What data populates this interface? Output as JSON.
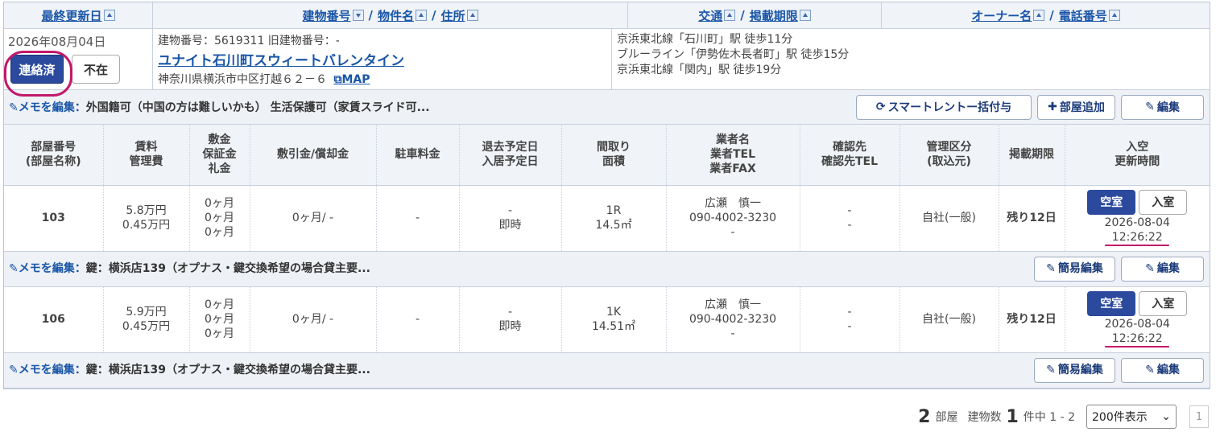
{
  "header": {
    "col1": "最終更新日",
    "col2a": "建物番号",
    "col2b": "物件名",
    "col2c": "住所",
    "col3a": "交通",
    "col3b": "掲載期限",
    "col4a": "オーナー名",
    "col4b": "電話番号",
    "sep": "/"
  },
  "building": {
    "date": "2026年08月04日",
    "contacted_label": "連絡済",
    "absent_label": "不在",
    "number_line": "建物番号：5619311 旧建物番号：-",
    "name": "ユナイト石川町スウィートバレンタイン",
    "address": "神奈川県横浜市中区打越６２－６",
    "map_label": "MAP",
    "transit": [
      "京浜東北線「石川町」駅 徒歩11分",
      "ブルーライン「伊勢佐木長者町」駅 徒歩15分",
      "京浜東北線「関内」駅 徒歩19分"
    ]
  },
  "building_memo": {
    "prefix": "メモを編集：",
    "text": "外国籍可（中国の方は難しいかも） 生活保護可（家賃スライド可...",
    "smart_label": "スマートレントー括付与",
    "add_room_label": "部屋追加",
    "edit_label": "編集"
  },
  "table_headers": [
    [
      "部屋番号",
      "(部屋名称)"
    ],
    [
      "賃料",
      "管理費"
    ],
    [
      "敷金",
      "保証金",
      "礼金"
    ],
    [
      "敷引金/償却金"
    ],
    [
      "駐車料金"
    ],
    [
      "退去予定日",
      "入居予定日"
    ],
    [
      "間取り",
      "面積"
    ],
    [
      "業者名",
      "業者TEL",
      "業者FAX"
    ],
    [
      "確認先",
      "確認先TEL"
    ],
    [
      "管理区分",
      "(取込元)"
    ],
    [
      "掲載期限"
    ],
    [
      "入空",
      "更新時間"
    ]
  ],
  "rooms": [
    {
      "number": "103",
      "rent": "5.8万円",
      "mgmt": "0.45万円",
      "deposit": [
        "0ヶ月",
        "0ヶ月",
        "0ヶ月"
      ],
      "shikibiki": "0ヶ月/ -",
      "parking": "-",
      "move_out": "-",
      "move_in": "即時",
      "layout": "1R",
      "area": "14.5㎡",
      "agent_name": "広瀬　慎一",
      "agent_tel": "090-4002-3230",
      "agent_fax": "-",
      "confirm": "-",
      "confirm_tel": "-",
      "mgmt_type": "自社(一般)",
      "deadline": "残り12日",
      "vacant_label": "空室",
      "enter_label": "入室",
      "update_date": "2026-08-04",
      "update_time": "12:26:22",
      "memo_prefix": "メモを編集：",
      "memo_text": "鍵：横浜店139（オプナス・鍵交換希望の場合貸主要...",
      "quick_edit_label": "簡易編集",
      "edit_label": "編集"
    },
    {
      "number": "106",
      "rent": "5.9万円",
      "mgmt": "0.45万円",
      "deposit": [
        "0ヶ月",
        "0ヶ月",
        "0ヶ月"
      ],
      "shikibiki": "0ヶ月/ -",
      "parking": "-",
      "move_out": "-",
      "move_in": "即時",
      "layout": "1K",
      "area": "14.51㎡",
      "agent_name": "広瀬　慎一",
      "agent_tel": "090-4002-3230",
      "agent_fax": "-",
      "confirm": "-",
      "confirm_tel": "-",
      "mgmt_type": "自社(一般)",
      "deadline": "残り12日",
      "vacant_label": "空室",
      "enter_label": "入室",
      "update_date": "2026-08-04",
      "update_time": "12:26:22",
      "memo_prefix": "メモを編集：",
      "memo_text": "鍵：横浜店139（オプナス・鍵交換希望の場合貸主要...",
      "quick_edit_label": "簡易編集",
      "edit_label": "編集"
    }
  ],
  "footer": {
    "room_count": "2",
    "room_label": "部屋",
    "building_label": "建物数",
    "building_count": "1",
    "range_label": "件中 1 - 2",
    "per_page": "200件表示",
    "page": "1"
  },
  "colors": {
    "primary": "#2b4a9e",
    "link": "#1a56a8",
    "highlight": "#c2186b"
  }
}
